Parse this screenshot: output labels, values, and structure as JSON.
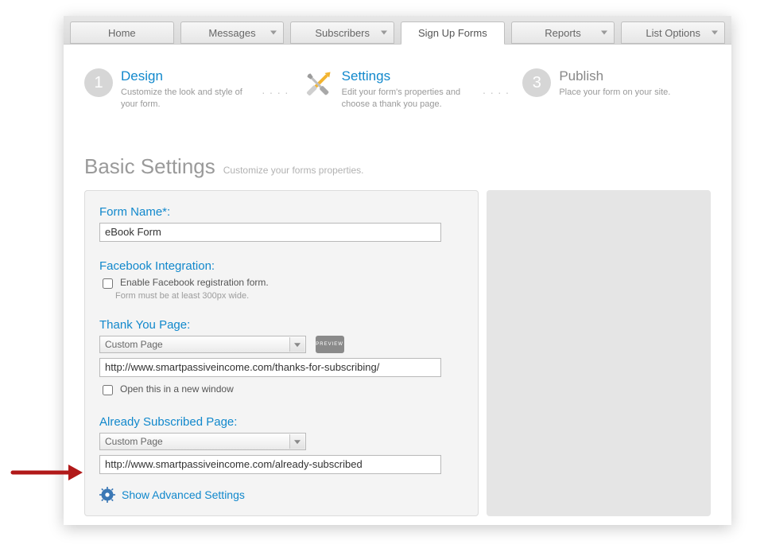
{
  "tabs": {
    "home": "Home",
    "messages": "Messages",
    "subscribers": "Subscribers",
    "signup": "Sign Up Forms",
    "reports": "Reports",
    "listoptions": "List Options"
  },
  "steps": {
    "design": {
      "num": "1",
      "title": "Design",
      "desc": "Customize the look and style of your form."
    },
    "settings": {
      "title": "Settings",
      "desc": "Edit your form's properties and choose a thank you page."
    },
    "publish": {
      "num": "3",
      "title": "Publish",
      "desc": "Place your form on your site."
    }
  },
  "section": {
    "title": "Basic Settings",
    "subtitle": "Customize your forms properties."
  },
  "form": {
    "name_label": "Form Name*:",
    "name_value": "eBook Form",
    "fb_label": "Facebook Integration:",
    "fb_check_label": "Enable Facebook registration form.",
    "fb_check_note": "Form must be at least 300px wide.",
    "thanks_label": "Thank You Page:",
    "thanks_select": "Custom Page",
    "preview_label": "PREVIEW",
    "thanks_url": "http://www.smartpassiveincome.com/thanks-for-subscribing/",
    "open_new_label": "Open this in a new window",
    "already_label": "Already Subscribed Page:",
    "already_select": "Custom Page",
    "already_url": "http://www.smartpassiveincome.com/already-subscribed",
    "advanced_label": "Show Advanced Settings"
  }
}
